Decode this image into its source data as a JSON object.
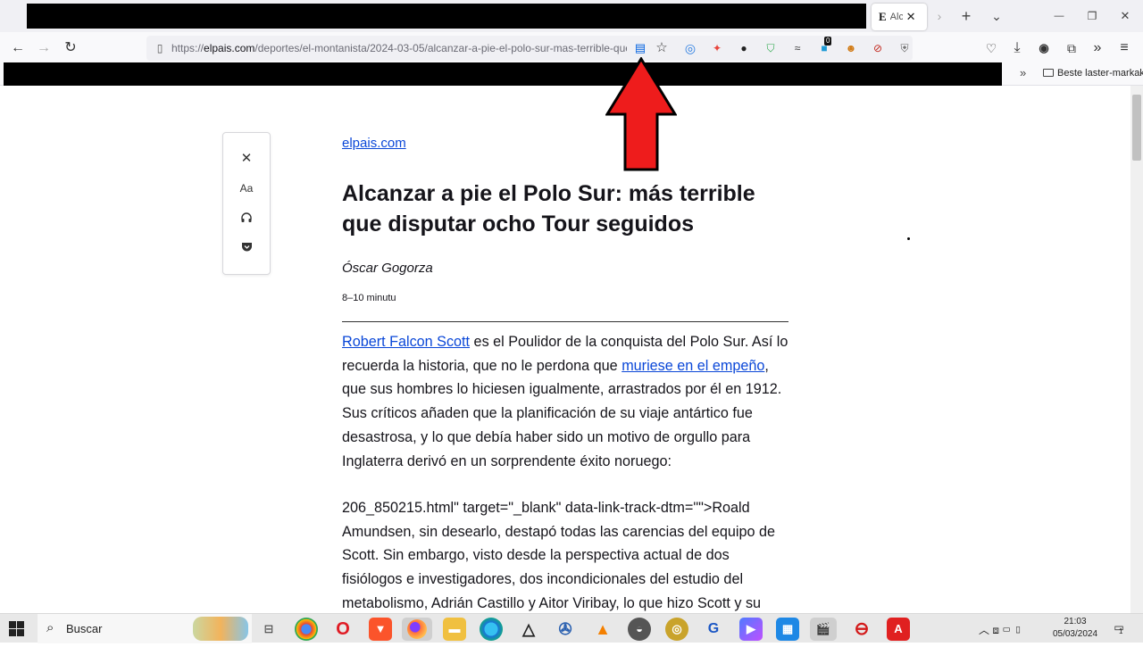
{
  "tab": {
    "favicon": "E",
    "title": "Alcanzar a pie el Polo Sur: más terrible que disputar ocho Tour seguidos",
    "close_glyph": "✕"
  },
  "toolbar": {
    "new_tab_glyph": "+",
    "list_tabs_glyph": "⌄"
  },
  "window": {
    "minimize": "—",
    "restore": "❐",
    "close": "✕"
  },
  "url": {
    "scheme": "https://",
    "domain": "elpais.com",
    "path": "/deportes/el-montanista/2024-03-05/alcanzar-a-pie-el-polo-sur-mas-terrible-que"
  },
  "bookmarks": {
    "overflow_glyph": "»",
    "folder_label": "Beste laster-markak"
  },
  "extensions": {
    "badge_count": "0"
  },
  "reader_toolbar": {
    "close_glyph": "✕",
    "type_label": "Aa"
  },
  "article": {
    "site": "elpais.com",
    "headline": "Alcanzar a pie el Polo Sur: más terrible que disputar ocho Tour seguidos",
    "author": "Óscar Gogorza",
    "read_time": "8–10 minutu",
    "p1_link1": "Robert Falcon Scott",
    "p1_text1": " es el Poulidor de la conquista del Polo Sur. Así lo recuerda la historia, que no le perdona que ",
    "p1_link2": "muriese en el empeño",
    "p1_text2": ", que sus hombres lo hiciesen igualmente, arrastrados por él en 1912. Sus críticos añaden que la planificación de su viaje antártico fue desastrosa, y lo que debía haber sido un motivo de orgullo para Inglaterra derivó en un sorprendente éxito noruego:",
    "p2_text": "206_850215.html\" target=\"_blank\" data-link-track-dtm=\"\">Roald Amundsen, sin desearlo, destapó todas las carencias del equipo de Scott. Sin embargo, visto desde la perspectiva actual de dos fisiólogos e investigadores, dos incondicionales del estudio del metabolismo, Adrián Castillo y Aitor Viribay, lo que hizo Scott y su"
  },
  "taskbar": {
    "search_label": "Buscar",
    "time": "21:03",
    "date": "05/03/2024",
    "notification_count": "1"
  }
}
